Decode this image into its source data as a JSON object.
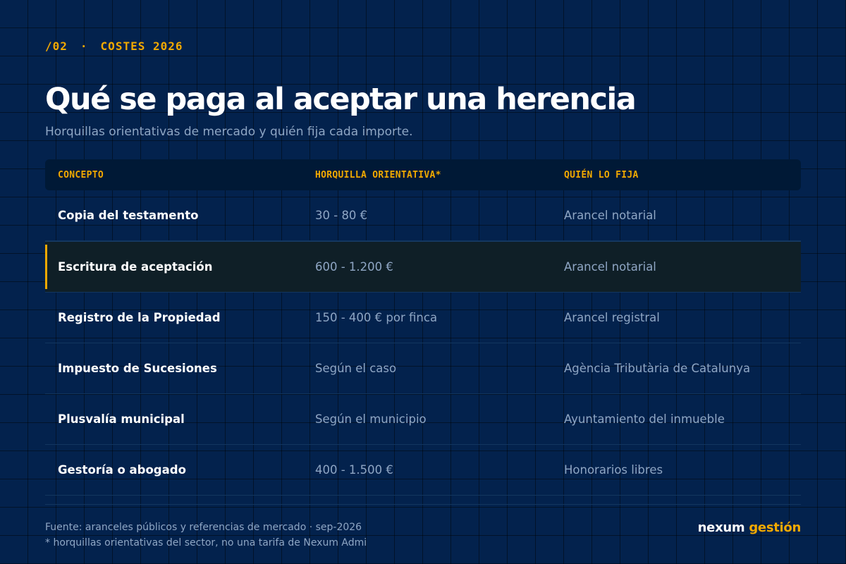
{
  "eyebrow": {
    "number": "/02",
    "separator": "·",
    "label": "COSTES 2026"
  },
  "title": "Qué se paga al aceptar una herencia",
  "subtitle": "Horquillas orientativas de mercado y quién fija cada importe.",
  "table": {
    "headers": [
      "CONCEPTO",
      "HORQUILLA ORIENTATIVA*",
      "QUIÉN LO FIJA"
    ],
    "rows": [
      {
        "concepto": "Copia del testamento",
        "horquilla": "30 - 80 €",
        "quien": "Arancel notarial",
        "highlighted": false
      },
      {
        "concepto": "Escritura de aceptación",
        "horquilla": "600 - 1.200 €",
        "quien": "Arancel notarial",
        "highlighted": true
      },
      {
        "concepto": "Registro de la Propiedad",
        "horquilla": "150 - 400 € por finca",
        "quien": "Arancel registral",
        "highlighted": false
      },
      {
        "concepto": "Impuesto de Sucesiones",
        "horquilla": "Según el caso",
        "quien": "Agència Tributària de Catalunya",
        "highlighted": false
      },
      {
        "concepto": "Plusvalía municipal",
        "horquilla": "Según el municipio",
        "quien": "Ayuntamiento del inmueble",
        "highlighted": false
      },
      {
        "concepto": "Gestoría o abogado",
        "horquilla": "400 - 1.500 €",
        "quien": "Honorarios libres",
        "highlighted": false
      }
    ]
  },
  "footer": {
    "source": "Fuente: aranceles públicos y referencias de mercado · sep-2026",
    "note": "* horquillas orientativas del sector, no una tarifa de Nexum Admi"
  },
  "brand": {
    "part1": "nexum",
    "part2": "gestión"
  },
  "colors": {
    "background": "#03224d",
    "accent": "#f2a900",
    "muted_text": "#8fa6c4",
    "highlight_row": "#0f1f27"
  }
}
